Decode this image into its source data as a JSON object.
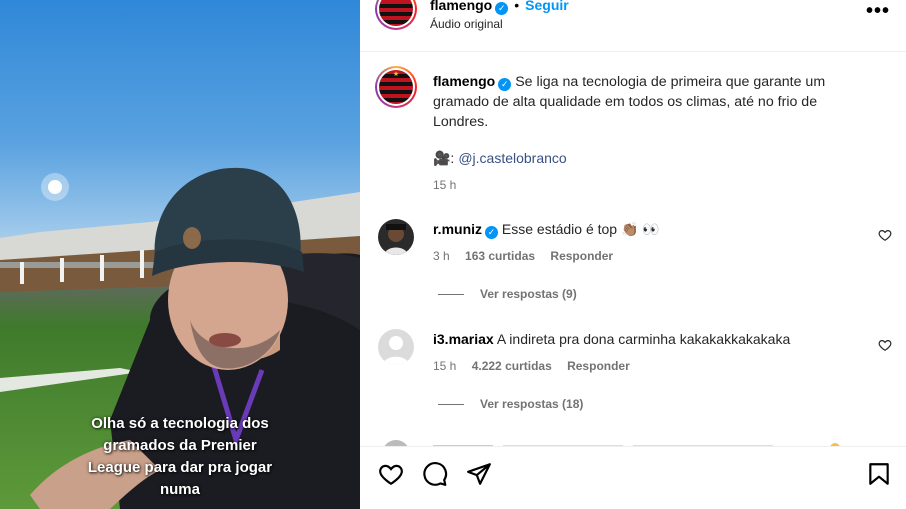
{
  "media": {
    "caption_overlay": "Olha só a tecnologia dos\ngramados da Premier\nLeague para dar pra jogar\nnuma"
  },
  "header": {
    "username": "flamengo",
    "separator": "•",
    "follow_label": "Seguir",
    "audio_label": "Áudio original",
    "more_label": "•••"
  },
  "post_caption": {
    "username": "flamengo",
    "text": "Se liga na tecnologia de primeira que garante um gramado de alta qualidade em todos os climas, até no frio de Londres.",
    "camera_emoji": "🎥:",
    "mention": "@j.castelobranco",
    "time": "15 h"
  },
  "comments": [
    {
      "username": "r.muniz",
      "verified": true,
      "text": "Esse estádio é top",
      "emoji": "👏🏽 👀",
      "time": "3 h",
      "likes": "163 curtidas",
      "reply_label": "Responder",
      "view_replies": "Ver respostas (9)"
    },
    {
      "username": "i3.mariax",
      "verified": false,
      "text": "A indireta pra dona carminha kakakakkakakaka",
      "emoji": "",
      "time": "15 h",
      "likes": "4.222 curtidas",
      "reply_label": "Responder",
      "view_replies": "Ver respostas (18)"
    }
  ],
  "icons": {
    "like": "heart-icon",
    "comment": "comment-icon",
    "share": "send-icon",
    "save": "bookmark-icon",
    "verified": "verified-badge-icon",
    "more": "more-options-icon"
  },
  "colors": {
    "link_blue": "#0095f6",
    "mention_blue": "#385185",
    "secondary_text": "#737373",
    "verified_blue": "#0095f6"
  }
}
